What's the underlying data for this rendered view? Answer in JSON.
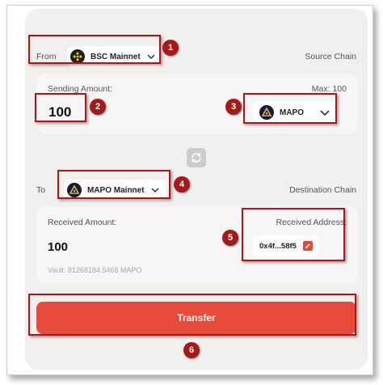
{
  "source": {
    "from_label": "From",
    "chain_name": "BSC Mainnet",
    "chain_caption": "Source Chain"
  },
  "sending": {
    "label": "Sending Amount:",
    "max_label": "Max: 100",
    "amount_value": "100",
    "token_name": "MAPO"
  },
  "destination": {
    "to_label": "To",
    "chain_name": "MAPO Mainnet",
    "chain_caption": "Destination Chain"
  },
  "received": {
    "label": "Received Amount:",
    "amount": "100",
    "vault_text": "Vault:  81268184.5468 MAPO",
    "address_label": "Received Address:",
    "address_value": "0x4f...58f5"
  },
  "transfer_label": "Transfer",
  "callouts": [
    "1",
    "2",
    "3",
    "4",
    "5",
    "6"
  ],
  "icons": {
    "source_chain": "bnb-logo-icon",
    "token": "mapo-logo-icon",
    "destination_chain": "mapo-logo-icon",
    "swap": "swap-arrows-icon",
    "dropdown": "chevron-down-icon",
    "edit": "edit-pencil-icon"
  },
  "colors": {
    "accent": "#e84a3c",
    "annotation": "#a31a1a",
    "card": "#f2efef",
    "panel": "#f7f5f5",
    "bnb": "#f3ba2f"
  }
}
